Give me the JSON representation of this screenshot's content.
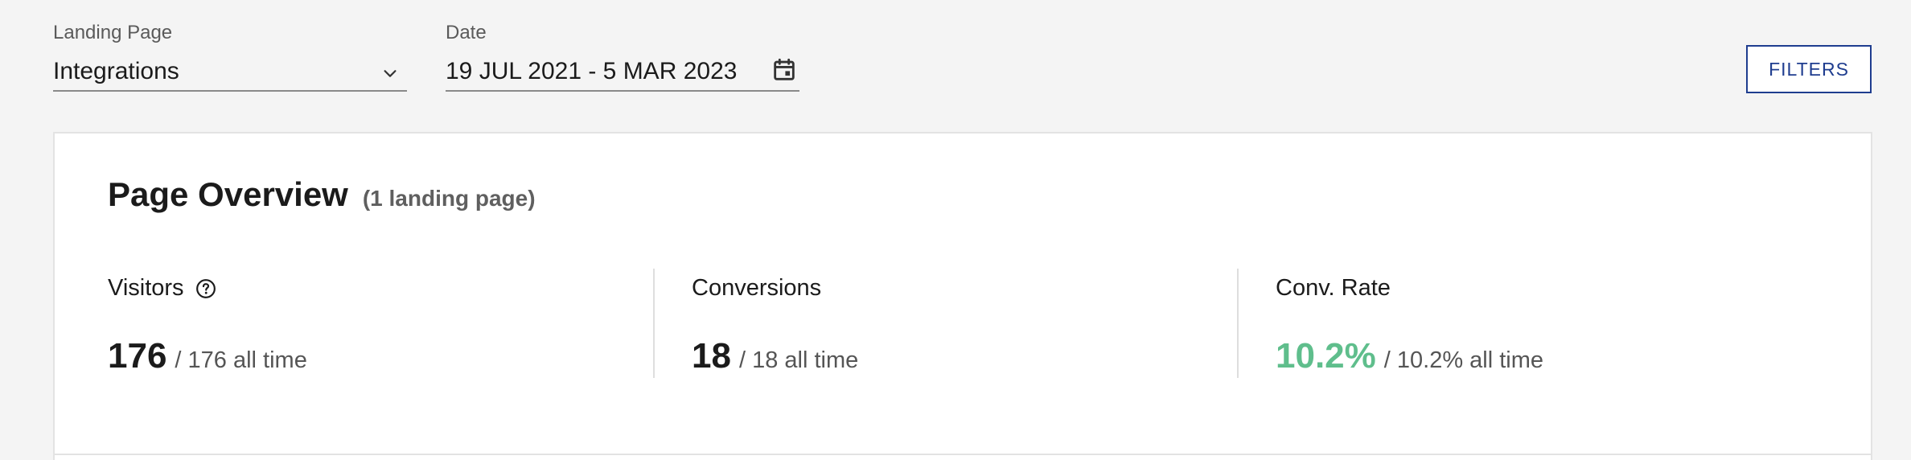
{
  "filters": {
    "landing_page": {
      "label": "Landing Page",
      "value": "Integrations",
      "icon": "chevron-down-icon"
    },
    "date": {
      "label": "Date",
      "value": "19 JUL 2021 - 5 MAR 2023",
      "icon": "calendar-icon"
    },
    "filters_button_label": "FILTERS"
  },
  "overview": {
    "title": "Page Overview",
    "subtitle": "(1 landing page)",
    "metrics": [
      {
        "label": "Visitors",
        "value": "176",
        "all_time": "/ 176 all time",
        "icon": "help-icon"
      },
      {
        "label": "Conversions",
        "value": "18",
        "all_time": "/ 18 all time"
      },
      {
        "label": "Conv. Rate",
        "value": "10.2%",
        "all_time": "/ 10.2% all time"
      }
    ]
  },
  "colors": {
    "accent_blue": "#1f3d8f",
    "accent_green": "#5fbe8c",
    "background": "#f4f4f4"
  }
}
